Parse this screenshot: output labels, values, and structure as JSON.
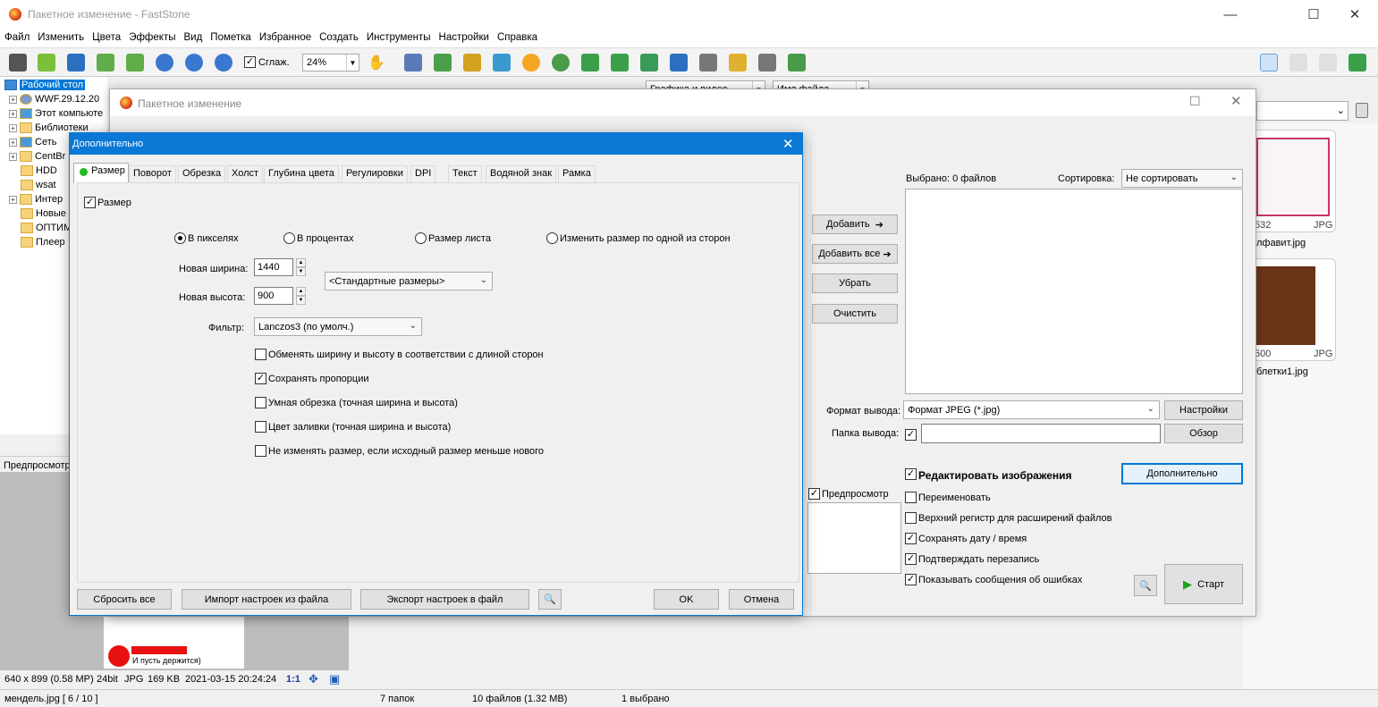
{
  "app": {
    "title": "Пакетное изменение - FastStone"
  },
  "menu": [
    "Файл",
    "Изменить",
    "Цвета",
    "Эффекты",
    "Вид",
    "Пометка",
    "Избранное",
    "Создать",
    "Инструменты",
    "Настройки",
    "Справка"
  ],
  "toolbar": {
    "smooth_label": "Сглаж.",
    "zoom": "24%"
  },
  "tree": {
    "items": [
      "Рабочий стол",
      "WWF.29.12.20",
      "Этот компьюте",
      "Библиотеки",
      "Сеть",
      "CentBr",
      "HDD",
      "wsat",
      "Интер",
      "Новые",
      "ОПТИМ",
      "Плеер"
    ]
  },
  "browser": {
    "filter_combo": "Графика и видео",
    "sort_combo": "Имя файла"
  },
  "preview": {
    "label": "Предпросмотр",
    "caption": "И пусть держится)",
    "info": [
      "640 x 899 (0.58 MP)",
      "24bit",
      "JPG",
      "169 KB",
      "2021-03-15 20:24:24",
      "1:1"
    ]
  },
  "statusbar": {
    "file": "мендель.jpg [ 6 / 10 ]",
    "folders": "7 папок",
    "files": "10 файлов (1.32 MB)",
    "selected": "1 выбрано"
  },
  "thumbs": [
    {
      "size": "532",
      "type": "JPG",
      "name": "лфавит.jpg"
    },
    {
      "size": "500",
      "type": "JPG",
      "name": "блетки1.jpg"
    }
  ],
  "batch": {
    "title": "Пакетное изменение",
    "selected_label": "Выбрано:  0 файлов",
    "sort_label": "Сортировка:",
    "sort_value": "Не сортировать",
    "buttons": {
      "add": "Добавить",
      "add_all": "Добавить все",
      "remove": "Убрать",
      "clear": "Очистить"
    },
    "output_format_label": "Формат вывода:",
    "output_format_value": "Формат JPEG (*.jpg)",
    "settings": "Настройки",
    "output_folder_label": "Папка вывода:",
    "browse": "Обзор",
    "preview_label": "Предпросмотр",
    "edit_images": "Редактировать изображения",
    "advanced": "Дополнительно",
    "options": [
      {
        "label": "Переименовать",
        "checked": false
      },
      {
        "label": "Верхний регистр для расширений файлов",
        "checked": false
      },
      {
        "label": "Сохранять дату / время",
        "checked": true
      },
      {
        "label": "Подтверждать перезапись",
        "checked": true
      },
      {
        "label": "Показывать сообщения об ошибках",
        "checked": true
      }
    ],
    "start": "Старт"
  },
  "dialog": {
    "title": "Дополнительно",
    "tabs": [
      "Размер",
      "Поворот",
      "Обрезка",
      "Холст",
      "Глубина цвета",
      "Регулировки",
      "DPI",
      "Текст",
      "Водяной знак",
      "Рамка"
    ],
    "size_checkbox": "Размер",
    "radios": [
      "В пикселях",
      "В процентах",
      "Размер листа",
      "Изменить размер по одной из сторон"
    ],
    "width_label": "Новая ширина:",
    "width_value": "1440",
    "height_label": "Новая высота:",
    "height_value": "900",
    "std_sizes": "<Стандартные размеры>",
    "filter_label": "Фильтр:",
    "filter_value": "Lanczos3 (по умолч.)",
    "checks": [
      {
        "label": "Обменять ширину и высоту в соответствии с длиной сторон",
        "checked": false
      },
      {
        "label": "Сохранять пропорции",
        "checked": true
      },
      {
        "label": "Умная обрезка (точная ширина и высота)",
        "checked": false
      },
      {
        "label": "Цвет заливки (точная ширина и высота)",
        "checked": false
      },
      {
        "label": "Не изменять размер, если исходный размер меньше нового",
        "checked": false
      }
    ],
    "reset": "Сбросить все",
    "import": "Импорт настроек из файла",
    "export": "Экспорт настроек в файл",
    "ok": "OK",
    "cancel": "Отмена"
  }
}
